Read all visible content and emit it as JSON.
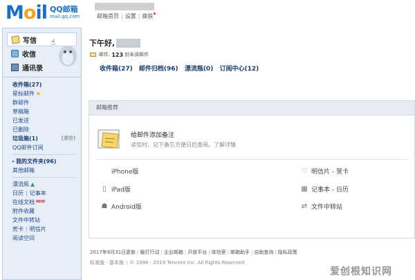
{
  "header": {
    "logo_word": "Mail",
    "logo_qq": "QQ邮箱",
    "logo_domain": "mail.qq.com",
    "links": [
      "邮箱首页",
      "设置",
      "换肤"
    ]
  },
  "sidebar": {
    "actions": [
      {
        "label": "写信",
        "icon": "pencil-icon"
      },
      {
        "label": "收信",
        "icon": "inbox-icon"
      },
      {
        "label": "通讯录",
        "icon": "contacts-icon"
      }
    ],
    "folders": [
      {
        "label": "收件箱(27)",
        "bold": true
      },
      {
        "label": "星标邮件",
        "star": true
      },
      {
        "label": "群邮件"
      },
      {
        "label": "草稿箱"
      },
      {
        "label": "已发送"
      },
      {
        "label": "已删除"
      },
      {
        "label": "垃圾箱(1)",
        "bold": true,
        "extra": "[清空]"
      },
      {
        "label": "QQ邮件订阅"
      }
    ],
    "my_folders": [
      {
        "label": "我的文件夹(96)",
        "bold": true
      },
      {
        "label": "其他邮箱"
      }
    ],
    "apps": [
      {
        "label": "漂流瓶"
      },
      {
        "label": "日历",
        "label2": "记事本"
      },
      {
        "label": "在线文档",
        "new": "NEW"
      },
      {
        "label": "附件收藏"
      },
      {
        "label": "文件中转站"
      },
      {
        "label": "贺卡",
        "label2": "明信片"
      },
      {
        "label": "阅读空间"
      }
    ]
  },
  "main": {
    "greeting": "下午好,",
    "mail_prefix": "邮件:",
    "mail_count": "123",
    "mail_suffix": "封未读邮件",
    "folder_links": [
      "收件箱(27)",
      "邮件归档(96)",
      "漂流瓶(0)",
      "订阅中心(12)"
    ],
    "recommend": {
      "title": "邮箱推荐",
      "note_title": "给邮件添加备注",
      "note_desc": "读信时，记下备忘方便日后查阅。了解详情",
      "features_left": [
        {
          "label": "iPhone版",
          "icon": "apple-icon"
        },
        {
          "label": "iPad版",
          "icon": "ipad-icon"
        },
        {
          "label": "Android版",
          "icon": "android-icon"
        }
      ],
      "features_right": [
        {
          "label": "明信片 - 贺卡",
          "icon": "heart-icon"
        },
        {
          "label": "记事本 - 日历",
          "icon": "calendar-icon"
        },
        {
          "label": "文件中转站",
          "icon": "transfer-icon"
        }
      ]
    },
    "footer_links": [
      "2017年8月31日更新",
      "暖灯行动",
      "企业邮箱",
      "开放平台",
      "体验室",
      "邮箱助手",
      "自助查询",
      "隐私政策"
    ],
    "footer_line2_a": "标准版 - 基本版",
    "footer_line2_b": "© 1998 - 2019 Tencent Inc. All Rights Reserved"
  },
  "watermark": "爱创根知识网"
}
